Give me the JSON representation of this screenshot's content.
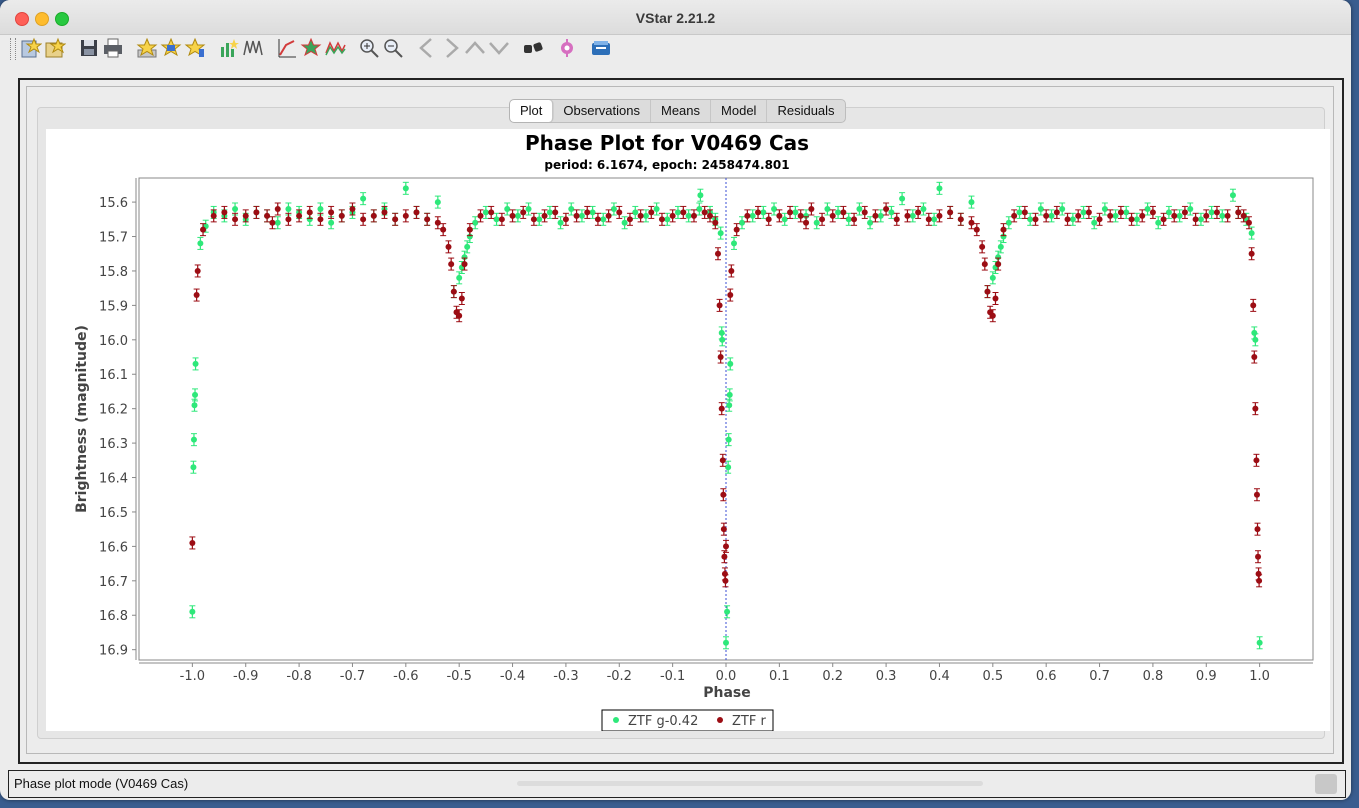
{
  "window": {
    "title": "VStar 2.21.2"
  },
  "toolbar": {
    "icons": [
      "new-star-icon",
      "open-file-icon",
      "save-icon",
      "print-icon",
      "star-info-icon",
      "star-add-icon",
      "star-favorite-icon",
      "plot-observations-icon",
      "plot-means-icon",
      "phase-plot-icon",
      "star-plot-icon",
      "model-curve-icon",
      "zoom-in-icon",
      "zoom-out-icon",
      "pan-left-icon",
      "pan-right-icon",
      "pan-up-icon",
      "pan-down-icon",
      "binoculars-icon",
      "plugin-icon",
      "info-icon"
    ]
  },
  "tabs": [
    {
      "label": "Plot",
      "active": true
    },
    {
      "label": "Observations",
      "active": false
    },
    {
      "label": "Means",
      "active": false
    },
    {
      "label": "Model",
      "active": false
    },
    {
      "label": "Residuals",
      "active": false
    }
  ],
  "status": {
    "text": "Phase plot mode (V0469 Cas)"
  },
  "colors": {
    "series_g": "#2ee87a",
    "series_r": "#9c0d14",
    "zero_line": "#3b4fd6"
  },
  "chart_data": {
    "type": "scatter",
    "title": "Phase Plot for V0469 Cas",
    "subtitle": "period: 6.1674, epoch: 2458474.801",
    "xlabel": "Phase",
    "ylabel": "Brightness (magnitude)",
    "xlim": [
      -1.1,
      1.1
    ],
    "ylim": [
      16.93,
      15.53
    ],
    "y_inverted": true,
    "xticks": [
      "-1.0",
      "-0.9",
      "-0.8",
      "-0.7",
      "-0.6",
      "-0.5",
      "-0.4",
      "-0.3",
      "-0.2",
      "-0.1",
      "0.0",
      "0.1",
      "0.2",
      "0.3",
      "0.4",
      "0.5",
      "0.6",
      "0.7",
      "0.8",
      "0.9",
      "1.0"
    ],
    "yticks": [
      "15.6",
      "15.7",
      "15.8",
      "15.9",
      "16.0",
      "16.1",
      "16.2",
      "16.3",
      "16.4",
      "16.5",
      "16.6",
      "16.7",
      "16.8",
      "16.9"
    ],
    "legend_position": "bottom-center",
    "series": [
      {
        "name": "ZTF g-0.42",
        "color": "#2ee87a",
        "points": [
          [
            -1.0,
            16.79
          ],
          [
            -0.998,
            16.37
          ],
          [
            -0.997,
            16.29
          ],
          [
            -0.996,
            16.19
          ],
          [
            -0.995,
            16.16
          ],
          [
            -0.994,
            16.07
          ],
          [
            -0.985,
            15.72
          ],
          [
            -0.975,
            15.67
          ],
          [
            -0.96,
            15.63
          ],
          [
            -0.94,
            15.64
          ],
          [
            -0.92,
            15.62
          ],
          [
            -0.9,
            15.65
          ],
          [
            -0.88,
            15.63
          ],
          [
            -0.86,
            15.64
          ],
          [
            -0.84,
            15.66
          ],
          [
            -0.82,
            15.62
          ],
          [
            -0.8,
            15.63
          ],
          [
            -0.78,
            15.65
          ],
          [
            -0.76,
            15.62
          ],
          [
            -0.74,
            15.66
          ],
          [
            -0.72,
            15.64
          ],
          [
            -0.7,
            15.63
          ],
          [
            -0.68,
            15.59
          ],
          [
            -0.66,
            15.64
          ],
          [
            -0.64,
            15.62
          ],
          [
            -0.62,
            15.65
          ],
          [
            -0.6,
            15.56
          ],
          [
            -0.58,
            15.63
          ],
          [
            -0.56,
            15.65
          ],
          [
            -0.54,
            15.6
          ],
          [
            -0.51,
            15.86
          ],
          [
            -0.5,
            15.82
          ],
          [
            -0.495,
            15.79
          ],
          [
            -0.49,
            15.76
          ],
          [
            -0.485,
            15.73
          ],
          [
            -0.48,
            15.7
          ],
          [
            -0.47,
            15.66
          ],
          [
            -0.45,
            15.63
          ],
          [
            -0.43,
            15.65
          ],
          [
            -0.41,
            15.62
          ],
          [
            -0.39,
            15.64
          ],
          [
            -0.37,
            15.62
          ],
          [
            -0.35,
            15.65
          ],
          [
            -0.33,
            15.63
          ],
          [
            -0.31,
            15.66
          ],
          [
            -0.29,
            15.62
          ],
          [
            -0.27,
            15.64
          ],
          [
            -0.25,
            15.63
          ],
          [
            -0.23,
            15.65
          ],
          [
            -0.21,
            15.62
          ],
          [
            -0.19,
            15.66
          ],
          [
            -0.17,
            15.63
          ],
          [
            -0.15,
            15.64
          ],
          [
            -0.13,
            15.62
          ],
          [
            -0.11,
            15.65
          ],
          [
            -0.09,
            15.63
          ],
          [
            -0.07,
            15.64
          ],
          [
            -0.05,
            15.62
          ],
          [
            -0.048,
            15.58
          ],
          [
            -0.03,
            15.63
          ],
          [
            -0.02,
            15.65
          ],
          [
            -0.01,
            15.69
          ],
          [
            -0.008,
            15.98
          ],
          [
            -0.007,
            16.0
          ],
          [
            0.0,
            16.88
          ],
          [
            0.002,
            16.79
          ],
          [
            0.004,
            16.37
          ],
          [
            0.005,
            16.29
          ],
          [
            0.006,
            16.19
          ],
          [
            0.007,
            16.16
          ],
          [
            0.008,
            16.07
          ],
          [
            0.015,
            15.72
          ],
          [
            0.03,
            15.66
          ],
          [
            0.05,
            15.64
          ],
          [
            0.07,
            15.63
          ],
          [
            0.09,
            15.62
          ],
          [
            0.11,
            15.65
          ],
          [
            0.13,
            15.63
          ],
          [
            0.15,
            15.64
          ],
          [
            0.17,
            15.66
          ],
          [
            0.19,
            15.62
          ],
          [
            0.21,
            15.63
          ],
          [
            0.23,
            15.65
          ],
          [
            0.25,
            15.62
          ],
          [
            0.27,
            15.66
          ],
          [
            0.29,
            15.64
          ],
          [
            0.31,
            15.63
          ],
          [
            0.33,
            15.59
          ],
          [
            0.35,
            15.64
          ],
          [
            0.37,
            15.62
          ],
          [
            0.39,
            15.65
          ],
          [
            0.4,
            15.56
          ],
          [
            0.42,
            15.63
          ],
          [
            0.44,
            15.65
          ],
          [
            0.46,
            15.6
          ],
          [
            0.49,
            15.86
          ],
          [
            0.5,
            15.82
          ],
          [
            0.505,
            15.79
          ],
          [
            0.51,
            15.76
          ],
          [
            0.515,
            15.73
          ],
          [
            0.52,
            15.7
          ],
          [
            0.53,
            15.66
          ],
          [
            0.55,
            15.63
          ],
          [
            0.57,
            15.65
          ],
          [
            0.59,
            15.62
          ],
          [
            0.61,
            15.64
          ],
          [
            0.63,
            15.62
          ],
          [
            0.65,
            15.65
          ],
          [
            0.67,
            15.63
          ],
          [
            0.69,
            15.66
          ],
          [
            0.71,
            15.62
          ],
          [
            0.73,
            15.64
          ],
          [
            0.75,
            15.63
          ],
          [
            0.77,
            15.65
          ],
          [
            0.79,
            15.62
          ],
          [
            0.81,
            15.66
          ],
          [
            0.83,
            15.63
          ],
          [
            0.85,
            15.64
          ],
          [
            0.87,
            15.62
          ],
          [
            0.89,
            15.65
          ],
          [
            0.91,
            15.63
          ],
          [
            0.93,
            15.64
          ],
          [
            0.95,
            15.58
          ],
          [
            0.96,
            15.63
          ],
          [
            0.975,
            15.65
          ],
          [
            0.985,
            15.69
          ],
          [
            0.99,
            15.98
          ],
          [
            0.992,
            16.0
          ],
          [
            1.0,
            16.88
          ]
        ]
      },
      {
        "name": "ZTF r",
        "color": "#9c0d14",
        "points": [
          [
            -1.0,
            16.59
          ],
          [
            -0.992,
            15.87
          ],
          [
            -0.99,
            15.8
          ],
          [
            -0.98,
            15.68
          ],
          [
            -0.96,
            15.64
          ],
          [
            -0.94,
            15.63
          ],
          [
            -0.92,
            15.65
          ],
          [
            -0.9,
            15.64
          ],
          [
            -0.88,
            15.63
          ],
          [
            -0.86,
            15.64
          ],
          [
            -0.85,
            15.66
          ],
          [
            -0.84,
            15.62
          ],
          [
            -0.82,
            15.65
          ],
          [
            -0.8,
            15.64
          ],
          [
            -0.78,
            15.63
          ],
          [
            -0.76,
            15.65
          ],
          [
            -0.74,
            15.63
          ],
          [
            -0.72,
            15.64
          ],
          [
            -0.7,
            15.62
          ],
          [
            -0.68,
            15.65
          ],
          [
            -0.66,
            15.64
          ],
          [
            -0.64,
            15.63
          ],
          [
            -0.62,
            15.65
          ],
          [
            -0.6,
            15.64
          ],
          [
            -0.58,
            15.63
          ],
          [
            -0.56,
            15.65
          ],
          [
            -0.54,
            15.66
          ],
          [
            -0.53,
            15.68
          ],
          [
            -0.52,
            15.73
          ],
          [
            -0.515,
            15.78
          ],
          [
            -0.51,
            15.86
          ],
          [
            -0.505,
            15.92
          ],
          [
            -0.5,
            15.93
          ],
          [
            -0.495,
            15.88
          ],
          [
            -0.49,
            15.78
          ],
          [
            -0.48,
            15.68
          ],
          [
            -0.46,
            15.64
          ],
          [
            -0.44,
            15.63
          ],
          [
            -0.42,
            15.65
          ],
          [
            -0.4,
            15.64
          ],
          [
            -0.38,
            15.63
          ],
          [
            -0.36,
            15.65
          ],
          [
            -0.34,
            15.64
          ],
          [
            -0.32,
            15.63
          ],
          [
            -0.3,
            15.65
          ],
          [
            -0.28,
            15.64
          ],
          [
            -0.26,
            15.63
          ],
          [
            -0.24,
            15.65
          ],
          [
            -0.22,
            15.64
          ],
          [
            -0.2,
            15.63
          ],
          [
            -0.18,
            15.65
          ],
          [
            -0.16,
            15.64
          ],
          [
            -0.14,
            15.63
          ],
          [
            -0.12,
            15.65
          ],
          [
            -0.1,
            15.64
          ],
          [
            -0.08,
            15.63
          ],
          [
            -0.06,
            15.64
          ],
          [
            -0.04,
            15.63
          ],
          [
            -0.03,
            15.64
          ],
          [
            -0.02,
            15.66
          ],
          [
            -0.015,
            15.75
          ],
          [
            -0.012,
            15.9
          ],
          [
            -0.01,
            16.05
          ],
          [
            -0.008,
            16.2
          ],
          [
            -0.006,
            16.35
          ],
          [
            -0.005,
            16.45
          ],
          [
            -0.004,
            16.55
          ],
          [
            -0.003,
            16.63
          ],
          [
            -0.002,
            16.68
          ],
          [
            -0.001,
            16.7
          ],
          [
            0.0,
            16.6
          ],
          [
            0.008,
            15.87
          ],
          [
            0.01,
            15.8
          ],
          [
            0.02,
            15.68
          ],
          [
            0.04,
            15.64
          ],
          [
            0.06,
            15.63
          ],
          [
            0.08,
            15.65
          ],
          [
            0.1,
            15.64
          ],
          [
            0.12,
            15.63
          ],
          [
            0.14,
            15.64
          ],
          [
            0.15,
            15.66
          ],
          [
            0.16,
            15.62
          ],
          [
            0.18,
            15.65
          ],
          [
            0.2,
            15.64
          ],
          [
            0.22,
            15.63
          ],
          [
            0.24,
            15.65
          ],
          [
            0.26,
            15.63
          ],
          [
            0.28,
            15.64
          ],
          [
            0.3,
            15.62
          ],
          [
            0.32,
            15.65
          ],
          [
            0.34,
            15.64
          ],
          [
            0.36,
            15.63
          ],
          [
            0.38,
            15.65
          ],
          [
            0.4,
            15.64
          ],
          [
            0.42,
            15.63
          ],
          [
            0.44,
            15.65
          ],
          [
            0.46,
            15.66
          ],
          [
            0.47,
            15.68
          ],
          [
            0.48,
            15.73
          ],
          [
            0.485,
            15.78
          ],
          [
            0.49,
            15.86
          ],
          [
            0.495,
            15.92
          ],
          [
            0.5,
            15.93
          ],
          [
            0.505,
            15.88
          ],
          [
            0.51,
            15.78
          ],
          [
            0.52,
            15.68
          ],
          [
            0.54,
            15.64
          ],
          [
            0.56,
            15.63
          ],
          [
            0.58,
            15.65
          ],
          [
            0.6,
            15.64
          ],
          [
            0.62,
            15.63
          ],
          [
            0.64,
            15.65
          ],
          [
            0.66,
            15.64
          ],
          [
            0.68,
            15.63
          ],
          [
            0.7,
            15.65
          ],
          [
            0.72,
            15.64
          ],
          [
            0.74,
            15.63
          ],
          [
            0.76,
            15.65
          ],
          [
            0.78,
            15.64
          ],
          [
            0.8,
            15.63
          ],
          [
            0.82,
            15.65
          ],
          [
            0.84,
            15.64
          ],
          [
            0.86,
            15.63
          ],
          [
            0.88,
            15.65
          ],
          [
            0.9,
            15.64
          ],
          [
            0.92,
            15.63
          ],
          [
            0.94,
            15.64
          ],
          [
            0.96,
            15.63
          ],
          [
            0.97,
            15.64
          ],
          [
            0.98,
            15.66
          ],
          [
            0.985,
            15.75
          ],
          [
            0.988,
            15.9
          ],
          [
            0.99,
            16.05
          ],
          [
            0.992,
            16.2
          ],
          [
            0.994,
            16.35
          ],
          [
            0.995,
            16.45
          ],
          [
            0.996,
            16.55
          ],
          [
            0.997,
            16.63
          ],
          [
            0.998,
            16.68
          ],
          [
            0.999,
            16.7
          ]
        ]
      }
    ]
  }
}
